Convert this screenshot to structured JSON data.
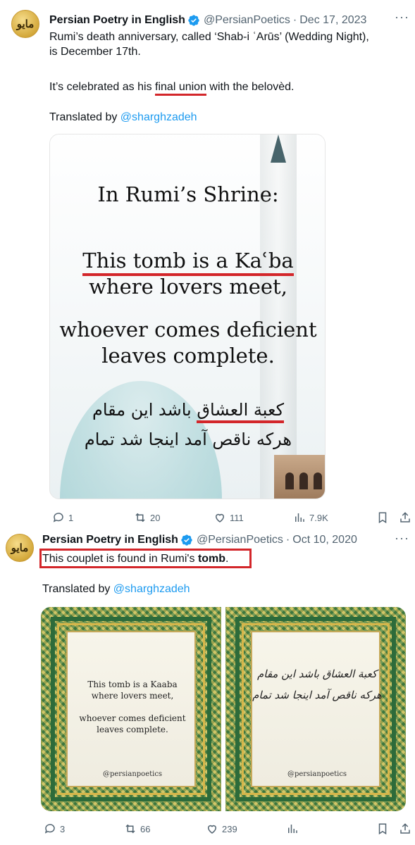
{
  "tweet1": {
    "avatar_text": "مایو",
    "author_name": "Persian Poetry in English",
    "handle": "@PersianPoetics",
    "separator": "·",
    "date": "Dec 17, 2023",
    "text_line1": "Rumi’s death anniversary, called ‘Shab-i ʿArūs’ (Wedding Night),",
    "text_line2": "is December 17th.",
    "text_para2_pre": "It’s celebrated as his ",
    "text_para2_highlight": "final union",
    "text_para2_post": " with the belovèd.",
    "translated_prefix": "Translated by ",
    "translator": "@sharghzadeh",
    "image": {
      "title": "In Rumi’s Shrine:",
      "line1": "This tomb is a Kaʿba",
      "line2": "where lovers meet,",
      "line3": "whoever comes deficient",
      "line4": "leaves complete.",
      "fa_line1_pre": "کعبة العشاق",
      "fa_line1_post": " باشد این مقام",
      "fa_line2": "هرکه ناقص آمد اینجا شد تمام"
    },
    "actions": {
      "replies": "1",
      "reposts": "20",
      "likes": "111",
      "views": "7.9K"
    }
  },
  "tweet2": {
    "avatar_text": "مایو",
    "author_name": "Persian Poetry in English",
    "handle": "@PersianPoetics",
    "separator": "·",
    "date": "Oct 10, 2020",
    "text_pre": "This couplet is found in Rumi's ",
    "text_bold": "tomb",
    "text_post": ".",
    "translated_prefix": "Translated by ",
    "translator": "@sharghzadeh",
    "image_left": {
      "line1": "This tomb is a Kaaba",
      "line2": "where lovers meet,",
      "line3": "whoever comes deficient",
      "line4": "leaves complete.",
      "credit": "@persianpoetics"
    },
    "image_right": {
      "fa_line1": "کعبة العشاق باشد این مقام",
      "fa_line2": "هرکه ناقص آمد اینجا شد تمام",
      "credit": "@persianpoetics"
    },
    "actions": {
      "replies": "3",
      "reposts": "66",
      "likes": "239"
    }
  },
  "colors": {
    "accent": "#1d9bf0",
    "highlight_red": "#d3262a",
    "muted": "#536471"
  },
  "icons": [
    "verified-badge-icon",
    "more-icon",
    "reply-icon",
    "repost-icon",
    "like-icon",
    "views-icon",
    "bookmark-icon",
    "share-icon"
  ]
}
